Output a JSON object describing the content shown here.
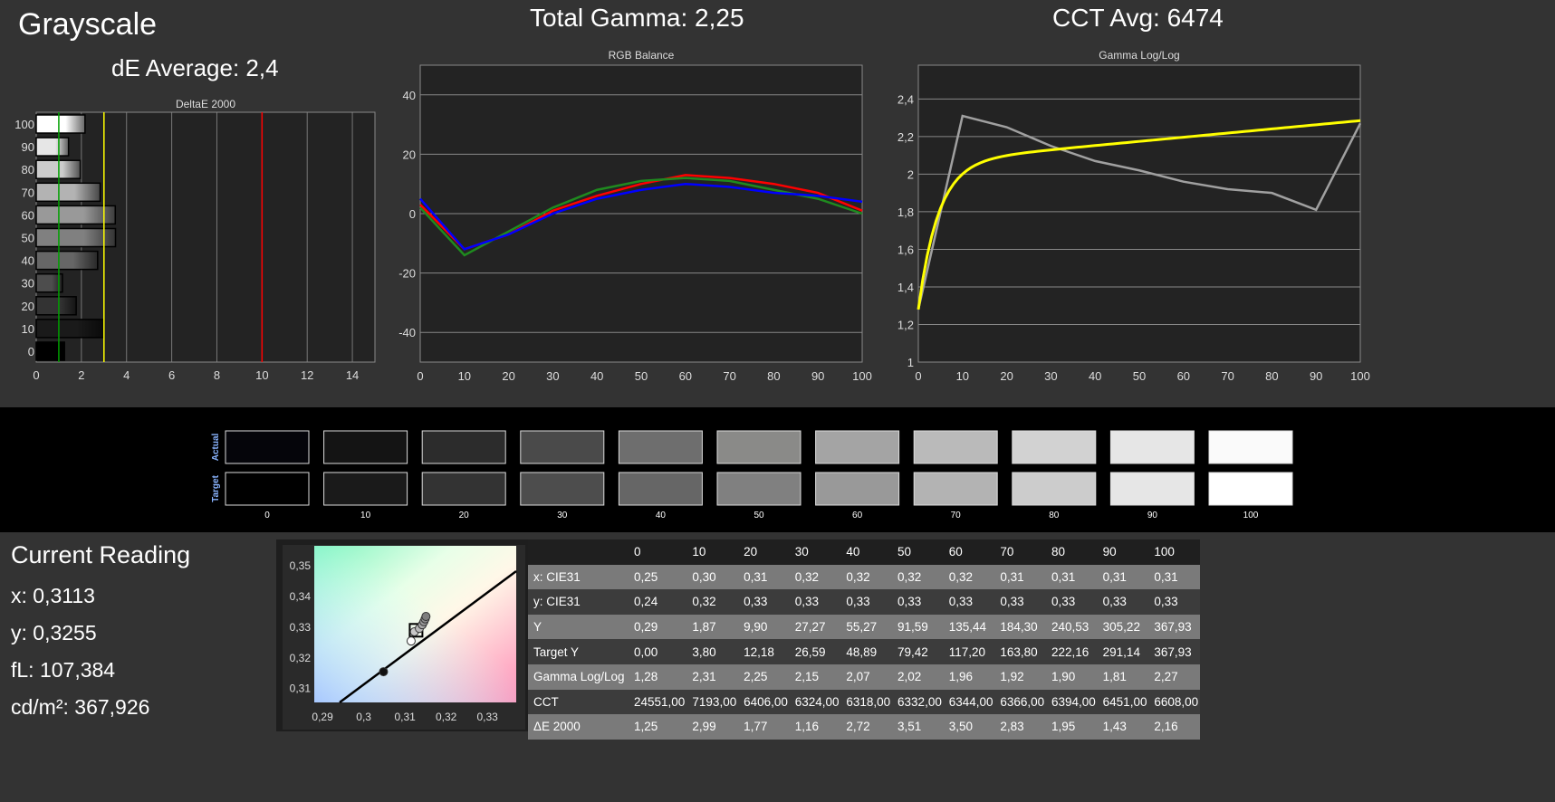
{
  "title": "Grayscale",
  "total_gamma": "Total Gamma: 2,25",
  "cct_avg": "CCT Avg: 6474",
  "de_average": "dE Average: 2,4",
  "colors": {
    "red_limit": "#ff0000",
    "yellow_limit": "#ffff00",
    "green_limit": "#00a000",
    "rgb_red": "#ff0000",
    "rgb_green": "#1f8a1f",
    "rgb_blue": "#0000ff",
    "gamma_target": "#ffff00",
    "gamma_measured": "#a0a0a0"
  },
  "chart_data": [
    {
      "type": "bar",
      "title": "DeltaE 2000",
      "orientation": "horizontal",
      "categories": [
        "0",
        "10",
        "20",
        "30",
        "40",
        "50",
        "60",
        "70",
        "80",
        "90",
        "100"
      ],
      "values": [
        1.25,
        2.99,
        1.77,
        1.16,
        2.72,
        3.51,
        3.5,
        2.83,
        1.95,
        1.43,
        2.16
      ],
      "xlim": [
        0,
        15
      ],
      "xticks": [
        "0",
        "2",
        "4",
        "6",
        "8",
        "10",
        "12",
        "14"
      ],
      "reference_lines": [
        1,
        3,
        10
      ],
      "grid": true
    },
    {
      "type": "line",
      "title": "RGB Balance",
      "x": [
        0,
        10,
        20,
        30,
        40,
        50,
        60,
        70,
        80,
        90,
        100
      ],
      "xlim": [
        0,
        100
      ],
      "ylim": [
        -50,
        50
      ],
      "xticks": [
        "0",
        "10",
        "20",
        "30",
        "40",
        "50",
        "60",
        "70",
        "80",
        "90",
        "100"
      ],
      "yticks": [
        "40",
        "20",
        "0",
        "-20",
        "-40"
      ],
      "grid": true,
      "series": [
        {
          "color": "red",
          "values": [
            3,
            -12,
            -7,
            1,
            6,
            10,
            13,
            12,
            10,
            7,
            1
          ]
        },
        {
          "color": "green",
          "values": [
            2,
            -14,
            -6,
            2,
            8,
            11,
            12,
            11,
            8,
            5,
            0
          ]
        },
        {
          "color": "blue",
          "values": [
            5,
            -12,
            -7,
            0,
            5,
            8,
            10,
            9,
            7,
            6,
            4
          ]
        }
      ]
    },
    {
      "type": "line",
      "title": "Gamma Log/Log",
      "x": [
        0,
        10,
        20,
        30,
        40,
        50,
        60,
        70,
        80,
        90,
        100
      ],
      "xlim": [
        0,
        100
      ],
      "ylim": [
        1,
        2.58
      ],
      "xticks": [
        "0",
        "10",
        "20",
        "30",
        "40",
        "50",
        "60",
        "70",
        "80",
        "90",
        "100"
      ],
      "yticks": [
        "2,4",
        "2,2",
        "2",
        "1,8",
        "1,6",
        "1,4",
        "1,2",
        "1"
      ],
      "grid": true,
      "series": [
        {
          "color": "gray",
          "values": [
            1.28,
            2.31,
            2.25,
            2.15,
            2.07,
            2.02,
            1.96,
            1.92,
            1.9,
            1.81,
            2.27
          ]
        },
        {
          "color": "yellow",
          "values": [
            1.28,
            2.02,
            2.13,
            2.18,
            2.21,
            2.23,
            2.245,
            2.255,
            2.265,
            2.27,
            2.28
          ]
        }
      ]
    },
    {
      "type": "scatter",
      "title": "",
      "xticks": [
        "0,29",
        "0,3",
        "0,31",
        "0,32",
        "0,33"
      ],
      "yticks": [
        "0,35",
        "0,34",
        "0,33",
        "0,32",
        "0,31"
      ],
      "xlim": [
        0.288,
        0.337
      ],
      "ylim": [
        0.3055,
        0.3565
      ],
      "points": [
        {
          "x": 0.3048,
          "y": 0.3155
        },
        {
          "x": 0.3115,
          "y": 0.3255
        },
        {
          "x": 0.3123,
          "y": 0.3285
        },
        {
          "x": 0.3135,
          "y": 0.3296
        },
        {
          "x": 0.3142,
          "y": 0.3308
        },
        {
          "x": 0.3146,
          "y": 0.3318
        },
        {
          "x": 0.3149,
          "y": 0.3327
        },
        {
          "x": 0.3151,
          "y": 0.3335
        }
      ],
      "target": {
        "x": 0.3127,
        "y": 0.329
      }
    }
  ],
  "swatches": {
    "actual_label": "Actual",
    "target_label": "Target",
    "labels": [
      "0",
      "10",
      "20",
      "30",
      "40",
      "50",
      "60",
      "70",
      "80",
      "90",
      "100"
    ],
    "actual": [
      "#05050a",
      "#141414",
      "#2c2c2c",
      "#4a4a4a",
      "#6e6e6e",
      "#8a8a88",
      "#a4a4a4",
      "#bababa",
      "#d2d2d2",
      "#e6e6e6",
      "#fafafa"
    ],
    "target": [
      "#000000",
      "#1a1a1a",
      "#333333",
      "#4d4d4d",
      "#666666",
      "#808080",
      "#999999",
      "#b3b3b3",
      "#cccccc",
      "#e6e6e6",
      "#ffffff"
    ]
  },
  "reading": {
    "title": "Current Reading",
    "x": "x: 0,3113",
    "y": "y: 0,3255",
    "fl": "fL: 107,384",
    "cd": "cd/m²: 367,926"
  },
  "table": {
    "header": [
      "",
      "0",
      "10",
      "20",
      "30",
      "40",
      "50",
      "60",
      "70",
      "80",
      "90",
      "100"
    ],
    "rows": [
      [
        "x: CIE31",
        "0,25",
        "0,30",
        "0,31",
        "0,32",
        "0,32",
        "0,32",
        "0,32",
        "0,31",
        "0,31",
        "0,31",
        "0,31"
      ],
      [
        "y: CIE31",
        "0,24",
        "0,32",
        "0,33",
        "0,33",
        "0,33",
        "0,33",
        "0,33",
        "0,33",
        "0,33",
        "0,33",
        "0,33"
      ],
      [
        "Y",
        "0,29",
        "1,87",
        "9,90",
        "27,27",
        "55,27",
        "91,59",
        "135,44",
        "184,30",
        "240,53",
        "305,22",
        "367,93"
      ],
      [
        "Target Y",
        "0,00",
        "3,80",
        "12,18",
        "26,59",
        "48,89",
        "79,42",
        "117,20",
        "163,80",
        "222,16",
        "291,14",
        "367,93"
      ],
      [
        "Gamma Log/Log",
        "1,28",
        "2,31",
        "2,25",
        "2,15",
        "2,07",
        "2,02",
        "1,96",
        "1,92",
        "1,90",
        "1,81",
        "2,27"
      ],
      [
        "CCT",
        "24551,00",
        "7193,00",
        "6406,00",
        "6324,00",
        "6318,00",
        "6332,00",
        "6344,00",
        "6366,00",
        "6394,00",
        "6451,00",
        "6608,00"
      ],
      [
        "ΔE 2000",
        "1,25",
        "2,99",
        "1,77",
        "1,16",
        "2,72",
        "3,51",
        "3,50",
        "2,83",
        "1,95",
        "1,43",
        "2,16"
      ]
    ]
  }
}
